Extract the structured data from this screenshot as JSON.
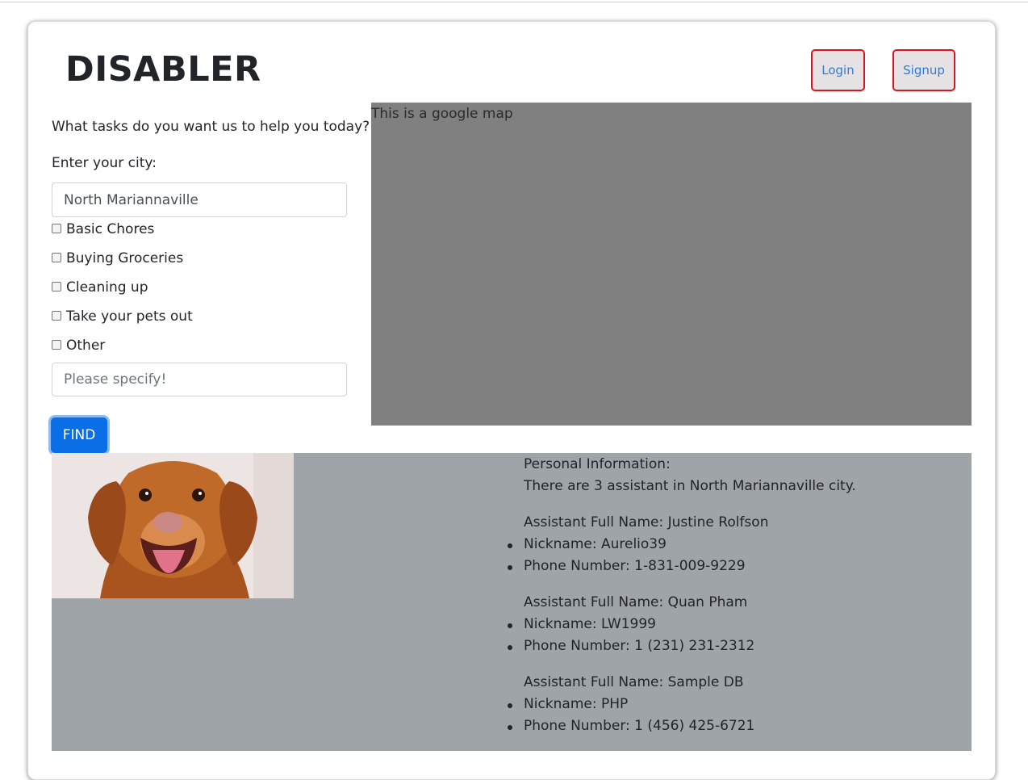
{
  "header": {
    "brand": "DISABLER",
    "login_label": "Login",
    "signup_label": "Signup"
  },
  "form": {
    "question": "What tasks do you want us to help you today?",
    "city_label": "Enter your city:",
    "city_value": "North Mariannaville",
    "tasks": [
      {
        "label": "Basic Chores",
        "checked": false
      },
      {
        "label": "Buying Groceries",
        "checked": false
      },
      {
        "label": "Cleaning up",
        "checked": false
      },
      {
        "label": "Take your pets out",
        "checked": false
      },
      {
        "label": "Other",
        "checked": false
      }
    ],
    "specify_placeholder": "Please specify!",
    "find_label": "FIND"
  },
  "map": {
    "text": "This is a google map"
  },
  "results": {
    "heading": "Personal Information:",
    "summary": "There are 3 assistant in North Mariannaville city.",
    "assistants": [
      {
        "full_name": "Assistant Full Name: Justine Rolfson",
        "nickname": "Nickname: Aurelio39",
        "phone": "Phone Number: 1-831-009-9229"
      },
      {
        "full_name": "Assistant Full Name: Quan Pham",
        "nickname": "Nickname: LW1999",
        "phone": "Phone Number: 1 (231) 231-2312"
      },
      {
        "full_name": "Assistant Full Name: Sample DB",
        "nickname": "Nickname: PHP",
        "phone": "Phone Number: 1 (456) 425-6721"
      }
    ]
  },
  "colors": {
    "accent": "#0a6ee6",
    "header_button_border": "#d9141c",
    "map_bg": "#808080",
    "results_bg": "#9ea4a8"
  }
}
